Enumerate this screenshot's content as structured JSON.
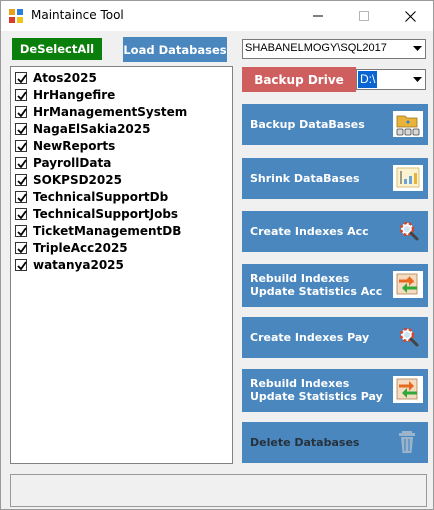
{
  "window": {
    "title": "Maintaince Tool"
  },
  "toolbar": {
    "deselect_label": "DeSelectAll",
    "load_label": "Load Databases",
    "server_value": "SHABANELMOGY\\SQL2017",
    "backup_label": "Backup Drive",
    "drive_value": "D:\\"
  },
  "databases": [
    {
      "name": "Atos2025",
      "checked": true
    },
    {
      "name": "HrHangefire",
      "checked": true
    },
    {
      "name": "HrManagementSystem",
      "checked": true
    },
    {
      "name": "NagaElSakia2025",
      "checked": true
    },
    {
      "name": "NewReports",
      "checked": true
    },
    {
      "name": "PayrollData",
      "checked": true
    },
    {
      "name": "SOKPSD2025",
      "checked": true
    },
    {
      "name": "TechnicalSupportDb",
      "checked": true
    },
    {
      "name": "TechnicalSupportJobs",
      "checked": true
    },
    {
      "name": "TicketManagementDB",
      "checked": true
    },
    {
      "name": "TripleAcc2025",
      "checked": true
    },
    {
      "name": "watanya2025",
      "checked": true
    }
  ],
  "actions": {
    "backup": {
      "label": "Backup DataBases",
      "icon": "database-backup-icon"
    },
    "shrink": {
      "label": "Shrink DataBases",
      "icon": "shrink-chart-icon"
    },
    "create_acc": {
      "label": "Create Indexes Acc",
      "icon": "magnifier-lifebuoy-icon"
    },
    "rebuild_acc": {
      "label_1": "Rebuild Indexes",
      "label_2": "Update Statistics Acc",
      "icon": "refresh-arrows-icon"
    },
    "create_pay": {
      "label": "Create Indexes Pay",
      "icon": "magnifier-lifebuoy-icon"
    },
    "rebuild_pay": {
      "label_1": "Rebuild Indexes",
      "label_2": "Update Statistics Pay",
      "icon": "refresh-arrows-icon"
    },
    "delete": {
      "label": "Delete Databases",
      "icon": "trash-icon"
    }
  },
  "colors": {
    "deselect": "#0b7f0b",
    "action_blue": "#4a87bf",
    "backup_red": "#cf5f5f",
    "selection": "#0a64d2"
  },
  "statusbar": {
    "text": ""
  }
}
